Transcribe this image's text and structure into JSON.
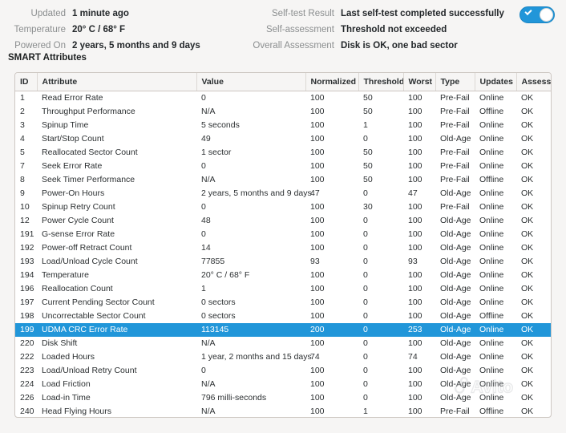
{
  "summary": {
    "left": [
      {
        "label": "Updated",
        "value": "1 minute ago"
      },
      {
        "label": "Temperature",
        "value": "20° C / 68° F"
      },
      {
        "label": "Powered On",
        "value": "2 years, 5 months and 9 days"
      }
    ],
    "right": [
      {
        "label": "Self-test Result",
        "value": "Last self-test completed successfully"
      },
      {
        "label": "Self-assessment",
        "value": "Threshold not exceeded"
      },
      {
        "label": "Overall Assessment",
        "value": "Disk is OK, one bad sector"
      }
    ],
    "toggle": {
      "name": "smart-enabled-toggle",
      "state": "on",
      "color": "#2196d9"
    }
  },
  "section": {
    "title": "SMART Attributes"
  },
  "table": {
    "columns": [
      "ID",
      "Attribute",
      "Value",
      "Normalized",
      "Threshold",
      "Worst",
      "Type",
      "Updates",
      "Assessment"
    ],
    "selected_row_index": 17,
    "selection_color": "#2196d9",
    "rows": [
      {
        "id": "1",
        "attribute": "Read Error Rate",
        "value": "0",
        "normalized": "100",
        "threshold": "50",
        "worst": "100",
        "type": "Pre-Fail",
        "updates": "Online",
        "assessment": "OK"
      },
      {
        "id": "2",
        "attribute": "Throughput Performance",
        "value": "N/A",
        "normalized": "100",
        "threshold": "50",
        "worst": "100",
        "type": "Pre-Fail",
        "updates": "Offline",
        "assessment": "OK"
      },
      {
        "id": "3",
        "attribute": "Spinup Time",
        "value": "5 seconds",
        "normalized": "100",
        "threshold": "1",
        "worst": "100",
        "type": "Pre-Fail",
        "updates": "Online",
        "assessment": "OK"
      },
      {
        "id": "4",
        "attribute": "Start/Stop Count",
        "value": "49",
        "normalized": "100",
        "threshold": "0",
        "worst": "100",
        "type": "Old-Age",
        "updates": "Online",
        "assessment": "OK"
      },
      {
        "id": "5",
        "attribute": "Reallocated Sector Count",
        "value": "1 sector",
        "normalized": "100",
        "threshold": "50",
        "worst": "100",
        "type": "Pre-Fail",
        "updates": "Online",
        "assessment": "OK"
      },
      {
        "id": "7",
        "attribute": "Seek Error Rate",
        "value": "0",
        "normalized": "100",
        "threshold": "50",
        "worst": "100",
        "type": "Pre-Fail",
        "updates": "Online",
        "assessment": "OK"
      },
      {
        "id": "8",
        "attribute": "Seek Timer Performance",
        "value": "N/A",
        "normalized": "100",
        "threshold": "50",
        "worst": "100",
        "type": "Pre-Fail",
        "updates": "Offline",
        "assessment": "OK"
      },
      {
        "id": "9",
        "attribute": "Power-On Hours",
        "value": "2 years, 5 months and 9 days",
        "normalized": "47",
        "threshold": "0",
        "worst": "47",
        "type": "Old-Age",
        "updates": "Online",
        "assessment": "OK"
      },
      {
        "id": "10",
        "attribute": "Spinup Retry Count",
        "value": "0",
        "normalized": "100",
        "threshold": "30",
        "worst": "100",
        "type": "Pre-Fail",
        "updates": "Online",
        "assessment": "OK"
      },
      {
        "id": "12",
        "attribute": "Power Cycle Count",
        "value": "48",
        "normalized": "100",
        "threshold": "0",
        "worst": "100",
        "type": "Old-Age",
        "updates": "Online",
        "assessment": "OK"
      },
      {
        "id": "191",
        "attribute": "G-sense Error Rate",
        "value": "0",
        "normalized": "100",
        "threshold": "0",
        "worst": "100",
        "type": "Old-Age",
        "updates": "Online",
        "assessment": "OK"
      },
      {
        "id": "192",
        "attribute": "Power-off Retract Count",
        "value": "14",
        "normalized": "100",
        "threshold": "0",
        "worst": "100",
        "type": "Old-Age",
        "updates": "Online",
        "assessment": "OK"
      },
      {
        "id": "193",
        "attribute": "Load/Unload Cycle Count",
        "value": "77855",
        "normalized": "93",
        "threshold": "0",
        "worst": "93",
        "type": "Old-Age",
        "updates": "Online",
        "assessment": "OK"
      },
      {
        "id": "194",
        "attribute": "Temperature",
        "value": "20° C / 68° F",
        "normalized": "100",
        "threshold": "0",
        "worst": "100",
        "type": "Old-Age",
        "updates": "Online",
        "assessment": "OK"
      },
      {
        "id": "196",
        "attribute": "Reallocation Count",
        "value": "1",
        "normalized": "100",
        "threshold": "0",
        "worst": "100",
        "type": "Old-Age",
        "updates": "Online",
        "assessment": "OK"
      },
      {
        "id": "197",
        "attribute": "Current Pending Sector Count",
        "value": "0 sectors",
        "normalized": "100",
        "threshold": "0",
        "worst": "100",
        "type": "Old-Age",
        "updates": "Online",
        "assessment": "OK"
      },
      {
        "id": "198",
        "attribute": "Uncorrectable Sector Count",
        "value": "0 sectors",
        "normalized": "100",
        "threshold": "0",
        "worst": "100",
        "type": "Old-Age",
        "updates": "Offline",
        "assessment": "OK"
      },
      {
        "id": "199",
        "attribute": "UDMA CRC Error Rate",
        "value": "113145",
        "normalized": "200",
        "threshold": "0",
        "worst": "253",
        "type": "Old-Age",
        "updates": "Online",
        "assessment": "OK"
      },
      {
        "id": "220",
        "attribute": "Disk Shift",
        "value": "N/A",
        "normalized": "100",
        "threshold": "0",
        "worst": "100",
        "type": "Old-Age",
        "updates": "Online",
        "assessment": "OK"
      },
      {
        "id": "222",
        "attribute": "Loaded Hours",
        "value": "1 year, 2 months and 15 days",
        "normalized": "74",
        "threshold": "0",
        "worst": "74",
        "type": "Old-Age",
        "updates": "Online",
        "assessment": "OK"
      },
      {
        "id": "223",
        "attribute": "Load/Unload Retry Count",
        "value": "0",
        "normalized": "100",
        "threshold": "0",
        "worst": "100",
        "type": "Old-Age",
        "updates": "Online",
        "assessment": "OK"
      },
      {
        "id": "224",
        "attribute": "Load Friction",
        "value": "N/A",
        "normalized": "100",
        "threshold": "0",
        "worst": "100",
        "type": "Old-Age",
        "updates": "Online",
        "assessment": "OK"
      },
      {
        "id": "226",
        "attribute": "Load-in Time",
        "value": "796 milli-seconds",
        "normalized": "100",
        "threshold": "0",
        "worst": "100",
        "type": "Old-Age",
        "updates": "Online",
        "assessment": "OK"
      },
      {
        "id": "240",
        "attribute": "Head Flying Hours",
        "value": "N/A",
        "normalized": "100",
        "threshold": "1",
        "worst": "100",
        "type": "Pre-Fail",
        "updates": "Offline",
        "assessment": "OK"
      }
    ]
  },
  "watermark": {
    "text": "Avito"
  }
}
